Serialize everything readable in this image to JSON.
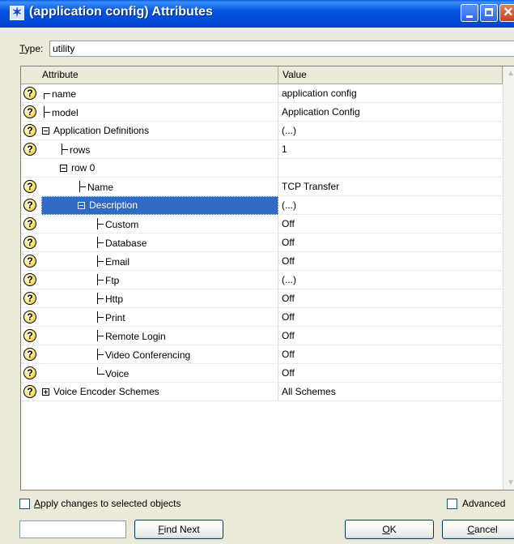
{
  "window": {
    "title": "(application config) Attributes"
  },
  "type_field": {
    "label_prefix": "T",
    "label_rest": "ype:",
    "value": "utility"
  },
  "table": {
    "headers": {
      "attribute": "Attribute",
      "value": "Value"
    },
    "rows": [
      {
        "attribute": "name",
        "value": "application config",
        "has_help": true,
        "indent": 0,
        "connector": "top",
        "expander": "none",
        "selected": false
      },
      {
        "attribute": "model",
        "value": "Application Config",
        "has_help": true,
        "indent": 0,
        "connector": "tee",
        "expander": "none",
        "selected": false
      },
      {
        "attribute": "Application Definitions",
        "value": "(...)",
        "has_help": true,
        "indent": 0,
        "connector": "none",
        "expander": "minus",
        "selected": false
      },
      {
        "attribute": "rows",
        "value": "1",
        "has_help": true,
        "indent": 1,
        "connector": "tee",
        "expander": "none",
        "selected": false
      },
      {
        "attribute": "row 0",
        "value": "",
        "has_help": false,
        "indent": 1,
        "connector": "none",
        "expander": "minus",
        "selected": false
      },
      {
        "attribute": "Name",
        "value": "TCP Transfer",
        "has_help": true,
        "indent": 2,
        "connector": "tee",
        "expander": "none",
        "selected": false
      },
      {
        "attribute": "Description",
        "value": "(...)",
        "has_help": true,
        "indent": 2,
        "connector": "none",
        "expander": "minus",
        "selected": true
      },
      {
        "attribute": "Custom",
        "value": "Off",
        "has_help": true,
        "indent": 3,
        "connector": "tee",
        "expander": "none",
        "selected": false
      },
      {
        "attribute": "Database",
        "value": "Off",
        "has_help": true,
        "indent": 3,
        "connector": "tee",
        "expander": "none",
        "selected": false
      },
      {
        "attribute": "Email",
        "value": "Off",
        "has_help": true,
        "indent": 3,
        "connector": "tee",
        "expander": "none",
        "selected": false
      },
      {
        "attribute": "Ftp",
        "value": "(...)",
        "has_help": true,
        "indent": 3,
        "connector": "tee",
        "expander": "none",
        "selected": false
      },
      {
        "attribute": "Http",
        "value": "Off",
        "has_help": true,
        "indent": 3,
        "connector": "tee",
        "expander": "none",
        "selected": false
      },
      {
        "attribute": "Print",
        "value": "Off",
        "has_help": true,
        "indent": 3,
        "connector": "tee",
        "expander": "none",
        "selected": false
      },
      {
        "attribute": "Remote Login",
        "value": "Off",
        "has_help": true,
        "indent": 3,
        "connector": "tee",
        "expander": "none",
        "selected": false
      },
      {
        "attribute": "Video Conferencing",
        "value": "Off",
        "has_help": true,
        "indent": 3,
        "connector": "tee",
        "expander": "none",
        "selected": false
      },
      {
        "attribute": "Voice",
        "value": "Off",
        "has_help": true,
        "indent": 3,
        "connector": "corner",
        "expander": "none",
        "selected": false
      },
      {
        "attribute": "Voice Encoder Schemes",
        "value": "All Schemes",
        "has_help": true,
        "indent": 0,
        "connector": "none",
        "expander": "plus",
        "selected": false
      }
    ],
    "help_glyph": "?"
  },
  "footer": {
    "apply_checkbox": {
      "label_prefix": "A",
      "label_rest": "pply changes to selected objects",
      "checked": false
    },
    "advanced_checkbox": {
      "label": "Advanced",
      "checked": false
    },
    "find_input_value": "",
    "find_next_label_prefix": "F",
    "find_next_label_rest": "ind Next",
    "ok_label_prefix": "O",
    "ok_label_rest": "K",
    "cancel_label_prefix": "C",
    "cancel_label_rest": "ancel"
  },
  "icons": {
    "app_icon": "star-icon",
    "minimize": "minimize-icon",
    "maximize": "maximize-icon",
    "close": "close-icon",
    "help": "help-icon"
  }
}
